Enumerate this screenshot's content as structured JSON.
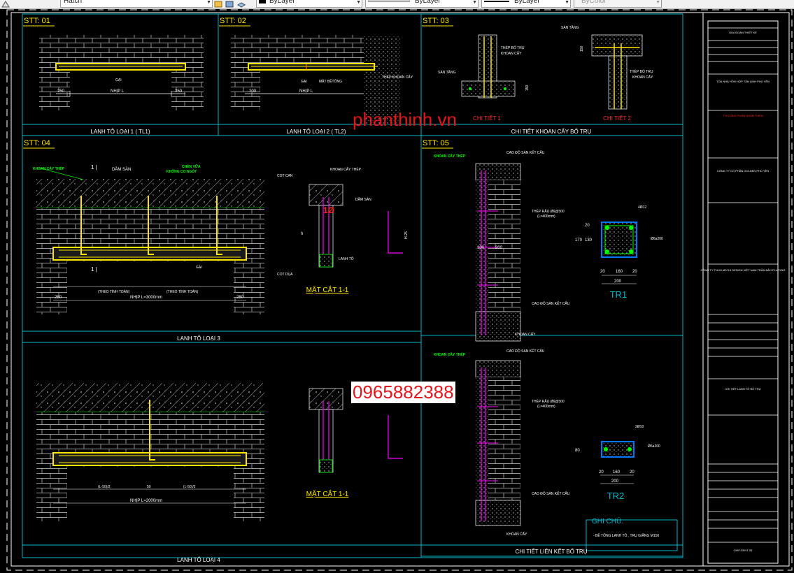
{
  "toolbar": {
    "hatch_label": "Hatch",
    "layer1": "ByLayer",
    "layer2": "ByLayer",
    "layer3": "ByLayer",
    "color": "ByColor"
  },
  "panels": {
    "p1": {
      "stt": "STT: 01",
      "caption": "LANH TÔ LOẠI 1 ( TL1)",
      "dim_left": "250",
      "dim_mid": "NHỊP L",
      "dim_right": "250",
      "label": "GẠI"
    },
    "p2": {
      "stt": "STT: 02",
      "caption": "LANH TÔ LOẠI 2 ( TL2)",
      "dim_left": "200",
      "dim_mid": "NHỊP L",
      "label1": "GẠI",
      "label2": "MẶT BÊTÔNG",
      "label3": "THÉP KHOAN CẤY"
    },
    "p3": {
      "stt": "STT: 03",
      "caption": "CHI TIẾT KHOAN CẤY BỔ TRỤ",
      "detail1": "CHI TIẾT 1",
      "detail2": "CHI TIẾT 2",
      "lbl_thep1": "THÉP BỔ TRỤ",
      "lbl_khoan1": "KHOAN CẤY",
      "lbl_san1": "SÀN TẦNG",
      "lbl_san2": "SÀN TẦNG",
      "lbl_thep2": "THÉP BỔ TRỤ",
      "lbl_khoan2": "KHOAN CẤY",
      "dim_a": "150",
      "dim_b": "150"
    },
    "p4": {
      "stt": "STT: 04",
      "caption": "LANH TÔ LOẠI 3",
      "lbl_khoan": "KHOAN CẤY THÉP",
      "lbl_dam": "DẦM SÀN",
      "lbl_chem": "CHÈN VỮA",
      "lbl_vua": "KHÔNG CO NGÓT",
      "sec_tag": "1 |",
      "sec_tag2": "1 |",
      "lbl_gai": "GẠI",
      "dim_theo1": "(THEO TÍNH TOÁN)",
      "dim_theo2": "(THEO TÍNH TOÁN)",
      "dim_nhip": "NHỊP L=3000mm",
      "dim_250a": "250",
      "dim_250b": "250",
      "cut_title": "MẶT CẮT 1-1",
      "cut_khoan": "KHOAN CẤY THÉP",
      "cut_dam": "DẦM SÀN",
      "cut_tot": "COT CAN",
      "cut_lanh": "LANH TÔ",
      "cut_cotdua": "COT DỤA",
      "cut_h": "h",
      "dim_h25": "H-25"
    },
    "p5": {
      "stt": "STT: 05",
      "caption": "CHI TIẾT LIÊN KẾT BỔ TRỤ",
      "lbl_khoan": "KHOAN CẤY THÉP",
      "lbl_cao1": "CAO ĐỘ SÀN KẾT CẤU",
      "lbl_thep_rau": "THÉP RÂU Ø6@500",
      "lbl_l400": "(L=400mm)",
      "lbl_cao2": "CAO ĐỘ SÀN KẾT CẤU",
      "lbl_khoancay": "KHOAN CẤY",
      "lbl_khoan_b": "KHOAN CẤY THÉP",
      "lbl_cao3": "CAO ĐỘ SÀN KẾT CẤU",
      "lbl_thep_rau_b": "THÉP RÂU Ø6@500",
      "lbl_l400_b": "(L=400mm)",
      "lbl_cao4": "CAO ĐỘ SÀN KẾT CẤU",
      "lbl_khoancay_b": "KHOAN CẤY",
      "dim_100": "100",
      "dim_200a": "200",
      "tr1": "TR1",
      "tr2": "TR2",
      "tr1_dims": [
        "20",
        "160",
        "20",
        "200"
      ],
      "tr1_v": [
        "20",
        "130",
        "170"
      ],
      "tr1_top": "4Ø12",
      "tr1_stir": "Ø6a200",
      "tr2_dims": [
        "20",
        "160",
        "20",
        "200"
      ],
      "tr2_v": "80",
      "tr2_top": "2Ø10",
      "tr2_stir": "Ø6a200"
    },
    "p6": {
      "caption": "LANH TÔ LOẠI 4",
      "dim_nhip": "NHỊP L=2000mm",
      "dim_half1": "(L-50)/2",
      "dim_half2": "(L-50)/2",
      "dim_50": "50",
      "cut_title": "MẶT CẮT 1-1"
    }
  },
  "notes": {
    "title": "GHI CHÚ:",
    "line1": "- BÊ TÔNG LANH TÔ , TRỤ GIẰNG M150"
  },
  "watermarks": {
    "site": "phanthinh.vn",
    "phone": "0965882388"
  },
  "title_block": {
    "header": "GIAI ĐOẠN THIẾT KẾ",
    "project": "TOÀ NHÀ HỖN HỢP TÂN LINH PHÚ YÊN",
    "stage": "THI CÔNG PHẦN HOÀN THIỆN",
    "owner": "CÔNG TY CỔ PHẦN GOLDEN PHÚ YÊN",
    "consultant": "CÔNG TY TNHH ARCHI DESIGN VIỆT NAM TRẦN BẢO PHƯƠNG",
    "drawing_name": "CHI TIẾT LANH TÔ BỔ TRỤ",
    "sheet": "CHIF-EFHT-05"
  }
}
